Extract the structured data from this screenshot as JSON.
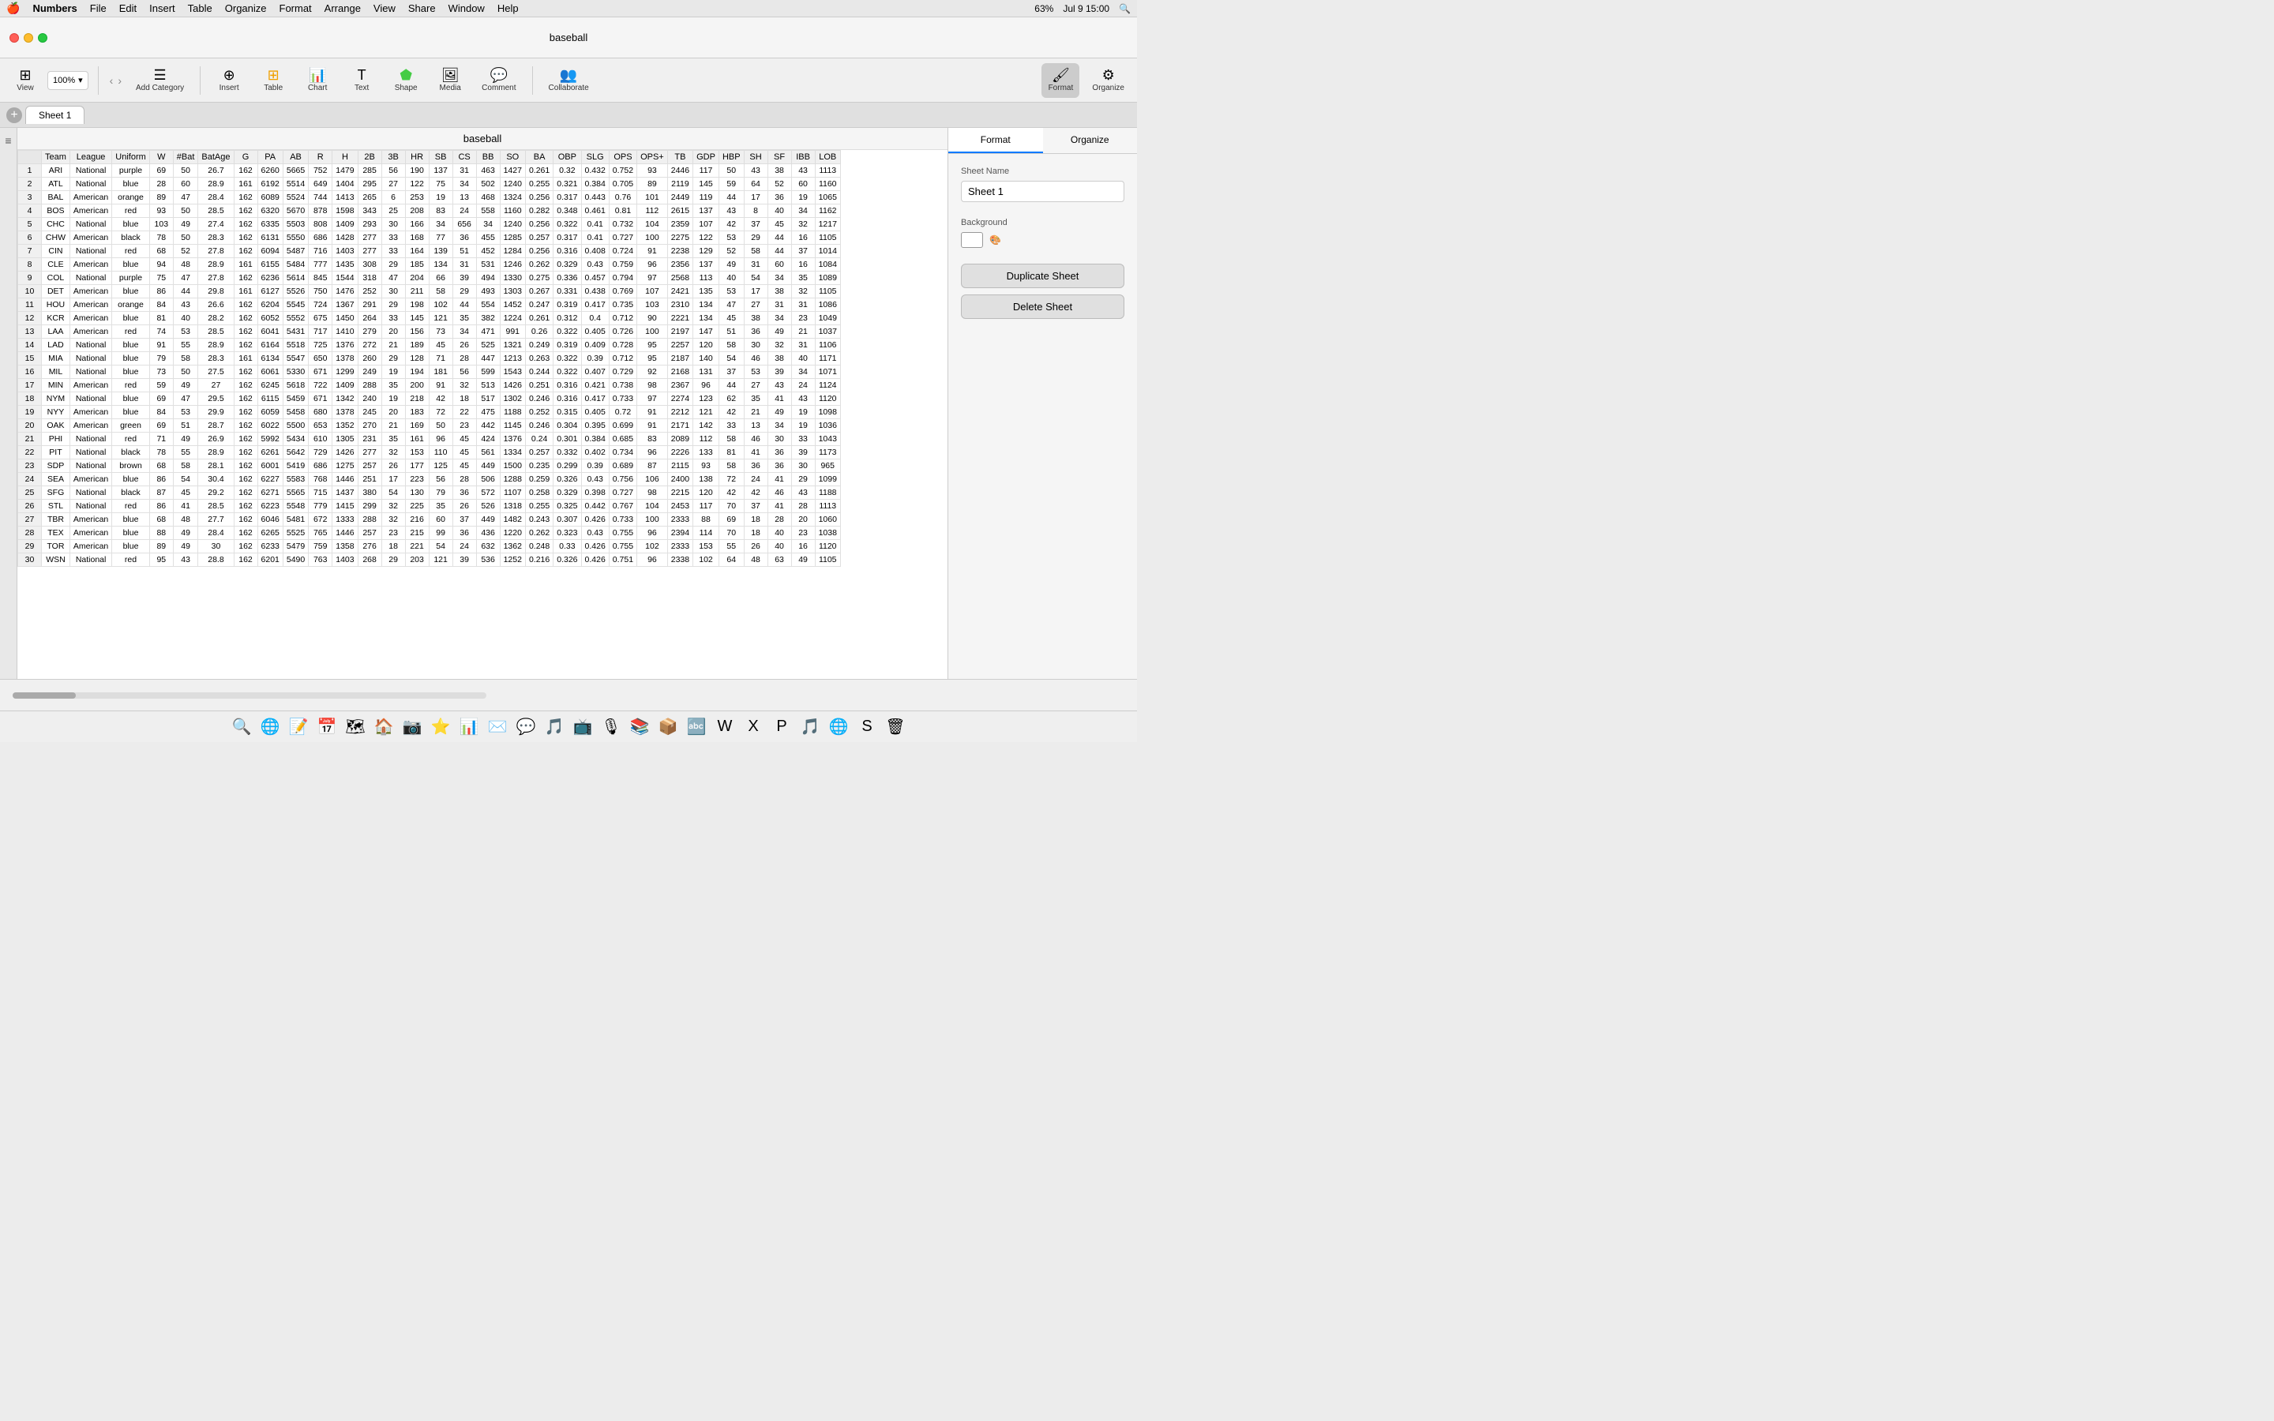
{
  "menubar": {
    "apple": "🍎",
    "app_name": "Numbers",
    "menus": [
      "File",
      "Edit",
      "Insert",
      "Table",
      "Organize",
      "Format",
      "Arrange",
      "View",
      "Share",
      "Window",
      "Help"
    ],
    "right_items": [
      "🔍",
      "Jul 9  15:00",
      "63%"
    ]
  },
  "titlebar": {
    "title": "baseball"
  },
  "toolbar": {
    "view_label": "View",
    "zoom_label": "100%",
    "add_category_label": "Add Category",
    "insert_label": "Insert",
    "table_label": "Table",
    "chart_label": "Chart",
    "text_label": "Text",
    "shape_label": "Shape",
    "media_label": "Media",
    "comment_label": "Comment",
    "collaborate_label": "Collaborate",
    "format_label": "Format",
    "organize_label": "Organize"
  },
  "sheet_tabs": {
    "tabs": [
      "Sheet 1"
    ]
  },
  "spreadsheet": {
    "title": "baseball",
    "columns": [
      "Team",
      "League",
      "Uniform",
      "W",
      "#Bat",
      "BatAge",
      "G",
      "PA",
      "AB",
      "R",
      "H",
      "2B",
      "3B",
      "HR",
      "SB",
      "CS",
      "BB",
      "SO",
      "BA",
      "OBP",
      "SLG",
      "OPS",
      "OPS+",
      "TB",
      "GDP",
      "HBP",
      "SH",
      "SF",
      "IBB",
      "LOB"
    ],
    "rows": [
      [
        "ARI",
        "National",
        "purple",
        "69",
        "50",
        "26.7",
        "162",
        "6260",
        "5665",
        "752",
        "1479",
        "285",
        "56",
        "190",
        "137",
        "31",
        "463",
        "1427",
        "0.261",
        "0.32",
        "0.432",
        "0.752",
        "93",
        "2446",
        "117",
        "50",
        "43",
        "38",
        "43",
        "1113"
      ],
      [
        "ATL",
        "National",
        "blue",
        "28",
        "60",
        "28.9",
        "161",
        "6192",
        "5514",
        "649",
        "1404",
        "295",
        "27",
        "122",
        "75",
        "34",
        "502",
        "1240",
        "0.255",
        "0.321",
        "0.384",
        "0.705",
        "89",
        "2119",
        "145",
        "59",
        "64",
        "52",
        "60",
        "1160"
      ],
      [
        "BAL",
        "American",
        "orange",
        "89",
        "47",
        "28.4",
        "162",
        "6089",
        "5524",
        "744",
        "1413",
        "265",
        "6",
        "253",
        "19",
        "13",
        "468",
        "1324",
        "0.256",
        "0.317",
        "0.443",
        "0.76",
        "101",
        "2449",
        "119",
        "44",
        "17",
        "36",
        "19",
        "1065"
      ],
      [
        "BOS",
        "American",
        "red",
        "93",
        "50",
        "28.5",
        "162",
        "6320",
        "5670",
        "878",
        "1598",
        "343",
        "25",
        "208",
        "83",
        "24",
        "558",
        "1160",
        "0.282",
        "0.348",
        "0.461",
        "0.81",
        "112",
        "2615",
        "137",
        "43",
        "8",
        "40",
        "34",
        "1162"
      ],
      [
        "CHC",
        "National",
        "blue",
        "103",
        "49",
        "27.4",
        "162",
        "6335",
        "5503",
        "808",
        "1409",
        "293",
        "30",
        "166",
        "34",
        "656",
        "34",
        "1240",
        "0.256",
        "0.322",
        "0.41",
        "0.732",
        "104",
        "2359",
        "107",
        "42",
        "37",
        "45",
        "32",
        "1217"
      ],
      [
        "CHW",
        "American",
        "black",
        "78",
        "50",
        "28.3",
        "162",
        "6131",
        "5550",
        "686",
        "1428",
        "277",
        "33",
        "168",
        "77",
        "36",
        "455",
        "1285",
        "0.257",
        "0.317",
        "0.41",
        "0.727",
        "100",
        "2275",
        "122",
        "53",
        "29",
        "44",
        "16",
        "1105"
      ],
      [
        "CIN",
        "National",
        "red",
        "68",
        "52",
        "27.8",
        "162",
        "6094",
        "5487",
        "716",
        "1403",
        "277",
        "33",
        "164",
        "139",
        "51",
        "452",
        "1284",
        "0.256",
        "0.316",
        "0.408",
        "0.724",
        "91",
        "2238",
        "129",
        "52",
        "58",
        "44",
        "37",
        "1014"
      ],
      [
        "CLE",
        "American",
        "blue",
        "94",
        "48",
        "28.9",
        "161",
        "6155",
        "5484",
        "777",
        "1435",
        "308",
        "29",
        "185",
        "134",
        "31",
        "531",
        "1246",
        "0.262",
        "0.329",
        "0.43",
        "0.759",
        "96",
        "2356",
        "137",
        "49",
        "31",
        "60",
        "16",
        "1084"
      ],
      [
        "COL",
        "National",
        "purple",
        "75",
        "47",
        "27.8",
        "162",
        "6236",
        "5614",
        "845",
        "1544",
        "318",
        "47",
        "204",
        "66",
        "39",
        "494",
        "1330",
        "0.275",
        "0.336",
        "0.457",
        "0.794",
        "97",
        "2568",
        "113",
        "40",
        "54",
        "34",
        "35",
        "1089"
      ],
      [
        "DET",
        "American",
        "blue",
        "86",
        "44",
        "29.8",
        "161",
        "6127",
        "5526",
        "750",
        "1476",
        "252",
        "30",
        "211",
        "58",
        "29",
        "493",
        "1303",
        "0.267",
        "0.331",
        "0.438",
        "0.769",
        "107",
        "2421",
        "135",
        "53",
        "17",
        "38",
        "32",
        "1105"
      ],
      [
        "HOU",
        "American",
        "orange",
        "84",
        "43",
        "26.6",
        "162",
        "6204",
        "5545",
        "724",
        "1367",
        "291",
        "29",
        "198",
        "102",
        "44",
        "554",
        "1452",
        "0.247",
        "0.319",
        "0.417",
        "0.735",
        "103",
        "2310",
        "134",
        "47",
        "27",
        "31",
        "31",
        "1086"
      ],
      [
        "KCR",
        "American",
        "blue",
        "81",
        "40",
        "28.2",
        "162",
        "6052",
        "5552",
        "675",
        "1450",
        "264",
        "33",
        "145",
        "121",
        "35",
        "382",
        "1224",
        "0.261",
        "0.312",
        "0.4",
        "0.712",
        "90",
        "2221",
        "134",
        "45",
        "38",
        "34",
        "23",
        "1049"
      ],
      [
        "LAA",
        "American",
        "red",
        "74",
        "53",
        "28.5",
        "162",
        "6041",
        "5431",
        "717",
        "1410",
        "279",
        "20",
        "156",
        "73",
        "34",
        "471",
        "991",
        "0.26",
        "0.322",
        "0.405",
        "0.726",
        "100",
        "2197",
        "147",
        "51",
        "36",
        "49",
        "21",
        "1037"
      ],
      [
        "LAD",
        "National",
        "blue",
        "91",
        "55",
        "28.9",
        "162",
        "6164",
        "5518",
        "725",
        "1376",
        "272",
        "21",
        "189",
        "45",
        "26",
        "525",
        "1321",
        "0.249",
        "0.319",
        "0.409",
        "0.728",
        "95",
        "2257",
        "120",
        "58",
        "30",
        "32",
        "31",
        "1106"
      ],
      [
        "MIA",
        "National",
        "blue",
        "79",
        "58",
        "28.3",
        "161",
        "6134",
        "5547",
        "650",
        "1378",
        "260",
        "29",
        "128",
        "71",
        "28",
        "447",
        "1213",
        "0.263",
        "0.322",
        "0.39",
        "0.712",
        "95",
        "2187",
        "140",
        "54",
        "46",
        "38",
        "40",
        "1171"
      ],
      [
        "MIL",
        "National",
        "blue",
        "73",
        "50",
        "27.5",
        "162",
        "6061",
        "5330",
        "671",
        "1299",
        "249",
        "19",
        "194",
        "181",
        "56",
        "599",
        "1543",
        "0.244",
        "0.322",
        "0.407",
        "0.729",
        "92",
        "2168",
        "131",
        "37",
        "53",
        "39",
        "34",
        "1071"
      ],
      [
        "MIN",
        "American",
        "red",
        "59",
        "49",
        "27",
        "162",
        "6245",
        "5618",
        "722",
        "1409",
        "288",
        "35",
        "200",
        "91",
        "32",
        "513",
        "1426",
        "0.251",
        "0.316",
        "0.421",
        "0.738",
        "98",
        "2367",
        "96",
        "44",
        "27",
        "43",
        "24",
        "1124"
      ],
      [
        "NYM",
        "National",
        "blue",
        "69",
        "47",
        "29.5",
        "162",
        "6115",
        "5459",
        "671",
        "1342",
        "240",
        "19",
        "218",
        "42",
        "18",
        "517",
        "1302",
        "0.246",
        "0.316",
        "0.417",
        "0.733",
        "97",
        "2274",
        "123",
        "62",
        "35",
        "41",
        "43",
        "1120"
      ],
      [
        "NYY",
        "American",
        "blue",
        "84",
        "53",
        "29.9",
        "162",
        "6059",
        "5458",
        "680",
        "1378",
        "245",
        "20",
        "183",
        "72",
        "22",
        "475",
        "1188",
        "0.252",
        "0.315",
        "0.405",
        "0.72",
        "91",
        "2212",
        "121",
        "42",
        "21",
        "49",
        "19",
        "1098"
      ],
      [
        "OAK",
        "American",
        "green",
        "69",
        "51",
        "28.7",
        "162",
        "6022",
        "5500",
        "653",
        "1352",
        "270",
        "21",
        "169",
        "50",
        "23",
        "442",
        "1145",
        "0.246",
        "0.304",
        "0.395",
        "0.699",
        "91",
        "2171",
        "142",
        "33",
        "13",
        "34",
        "19",
        "1036"
      ],
      [
        "PHI",
        "National",
        "red",
        "71",
        "49",
        "26.9",
        "162",
        "5992",
        "5434",
        "610",
        "1305",
        "231",
        "35",
        "161",
        "96",
        "45",
        "424",
        "1376",
        "0.24",
        "0.301",
        "0.384",
        "0.685",
        "83",
        "2089",
        "112",
        "58",
        "46",
        "30",
        "33",
        "1043"
      ],
      [
        "PIT",
        "National",
        "black",
        "78",
        "55",
        "28.9",
        "162",
        "6261",
        "5642",
        "729",
        "1426",
        "277",
        "32",
        "153",
        "110",
        "45",
        "561",
        "1334",
        "0.257",
        "0.332",
        "0.402",
        "0.734",
        "96",
        "2226",
        "133",
        "81",
        "41",
        "36",
        "39",
        "1173"
      ],
      [
        "SDP",
        "National",
        "brown",
        "68",
        "58",
        "28.1",
        "162",
        "6001",
        "5419",
        "686",
        "1275",
        "257",
        "26",
        "177",
        "125",
        "45",
        "449",
        "1500",
        "0.235",
        "0.299",
        "0.39",
        "0.689",
        "87",
        "2115",
        "93",
        "58",
        "36",
        "36",
        "30",
        "965"
      ],
      [
        "SEA",
        "American",
        "blue",
        "86",
        "54",
        "30.4",
        "162",
        "6227",
        "5583",
        "768",
        "1446",
        "251",
        "17",
        "223",
        "56",
        "28",
        "506",
        "1288",
        "0.259",
        "0.326",
        "0.43",
        "0.756",
        "106",
        "2400",
        "138",
        "72",
        "24",
        "41",
        "29",
        "1099"
      ],
      [
        "SFG",
        "National",
        "black",
        "87",
        "45",
        "29.2",
        "162",
        "6271",
        "5565",
        "715",
        "1437",
        "380",
        "54",
        "130",
        "79",
        "36",
        "572",
        "1107",
        "0.258",
        "0.329",
        "0.398",
        "0.727",
        "98",
        "2215",
        "120",
        "42",
        "42",
        "46",
        "43",
        "1188"
      ],
      [
        "STL",
        "National",
        "red",
        "86",
        "41",
        "28.5",
        "162",
        "6223",
        "5548",
        "779",
        "1415",
        "299",
        "32",
        "225",
        "35",
        "26",
        "526",
        "1318",
        "0.255",
        "0.325",
        "0.442",
        "0.767",
        "104",
        "2453",
        "117",
        "70",
        "37",
        "41",
        "28",
        "1113"
      ],
      [
        "TBR",
        "American",
        "blue",
        "68",
        "48",
        "27.7",
        "162",
        "6046",
        "5481",
        "672",
        "1333",
        "288",
        "32",
        "216",
        "60",
        "37",
        "449",
        "1482",
        "0.243",
        "0.307",
        "0.426",
        "0.733",
        "100",
        "2333",
        "88",
        "69",
        "18",
        "28",
        "20",
        "1060"
      ],
      [
        "TEX",
        "American",
        "blue",
        "88",
        "49",
        "28.4",
        "162",
        "6265",
        "5525",
        "765",
        "1446",
        "257",
        "23",
        "215",
        "99",
        "36",
        "436",
        "1220",
        "0.262",
        "0.323",
        "0.43",
        "0.755",
        "96",
        "2394",
        "114",
        "70",
        "18",
        "40",
        "23",
        "1038"
      ],
      [
        "TOR",
        "American",
        "blue",
        "89",
        "49",
        "30",
        "162",
        "6233",
        "5479",
        "759",
        "1358",
        "276",
        "18",
        "221",
        "54",
        "24",
        "632",
        "1362",
        "0.248",
        "0.33",
        "0.426",
        "0.755",
        "102",
        "2333",
        "153",
        "55",
        "26",
        "40",
        "16",
        "1120"
      ],
      [
        "WSN",
        "National",
        "red",
        "95",
        "43",
        "28.8",
        "162",
        "6201",
        "5490",
        "763",
        "1403",
        "268",
        "29",
        "203",
        "121",
        "39",
        "536",
        "1252",
        "0.216",
        "0.326",
        "0.426",
        "0.751",
        "96",
        "2338",
        "102",
        "64",
        "48",
        "63",
        "49",
        "1105"
      ]
    ]
  },
  "right_panel": {
    "tabs": [
      "Format",
      "Organize"
    ],
    "sheet_name_label": "Sheet Name",
    "sheet_name_value": "Sheet 1",
    "background_label": "Background",
    "duplicate_sheet_label": "Duplicate Sheet",
    "delete_sheet_label": "Delete Sheet"
  },
  "statusbar": {},
  "dock": {
    "icons": [
      "🔍",
      "🌐",
      "📝",
      "📅",
      "🗺",
      "🏠",
      "📸",
      "⭐",
      "📊",
      "📧",
      "📱",
      "🎵",
      "📺",
      "🍿",
      "📚",
      "📦",
      "🔤",
      "💼",
      "🖥",
      "📊",
      "🔑",
      "🌐",
      "🟠",
      "💬",
      "🍎",
      "🗑"
    ]
  }
}
